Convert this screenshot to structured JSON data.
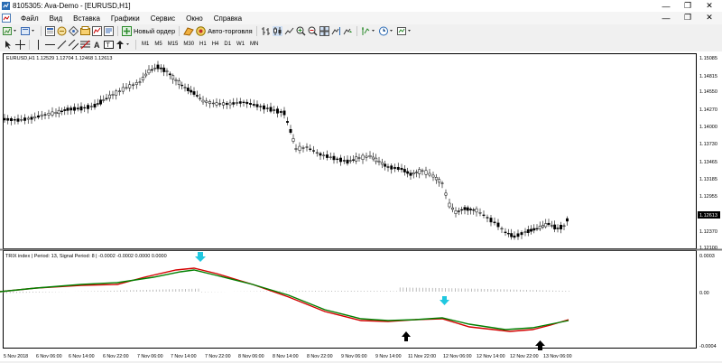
{
  "window": {
    "title": "8105305: Ava-Demo - [EURUSD,H1]",
    "controls": [
      "—",
      "❐",
      "✕"
    ]
  },
  "menu": {
    "items": [
      "Файл",
      "Вид",
      "Вставка",
      "Графики",
      "Сервис",
      "Окно",
      "Справка"
    ],
    "controls": [
      "—",
      "❐",
      "✕"
    ]
  },
  "toolbar": {
    "new_order_label": "Новый ордер",
    "autotrading_label": "Авто-торговля",
    "timeframes": [
      "M1",
      "M5",
      "M15",
      "M30",
      "H1",
      "H4",
      "D1",
      "W1",
      "MN"
    ]
  },
  "chart": {
    "header": "EURUSD,H1  1.12529 1.12704 1.12468 1.12613",
    "indicator_header": "TRIX index | Period: 13, Signal Period: 8 |  -0.0002 -0.0002 0.0000 0.0000",
    "price_labels": [
      "1.15085",
      "1.14815",
      "1.14550",
      "1.14270",
      "1.14000",
      "1.13730",
      "1.13465",
      "1.13185",
      "1.12955",
      "1.12613",
      "1.12370",
      "1.12100"
    ],
    "current_price": "1.12613",
    "indicator_labels": [
      "0.0003",
      "0.00",
      "-0.0004"
    ],
    "time_labels": [
      "5 Nov 2018",
      "6 Nov 06:00",
      "6 Nov 14:00",
      "6 Nov 22:00",
      "7 Nov 06:00",
      "7 Nov 14:00",
      "7 Nov 22:00",
      "8 Nov 06:00",
      "8 Nov 14:00",
      "8 Nov 22:00",
      "9 Nov 06:00",
      "9 Nov 14:00",
      "11 Nov 22:00",
      "12 Nov 06:00",
      "12 Nov 14:00",
      "12 Nov 22:00",
      "13 Nov 06:00"
    ],
    "colors": {
      "signal_line": "#d40000",
      "trix_line": "#008000",
      "arrow_up": "#000000",
      "arrow_down": "#20c8e0",
      "histogram": "#a0a0a0"
    }
  }
}
